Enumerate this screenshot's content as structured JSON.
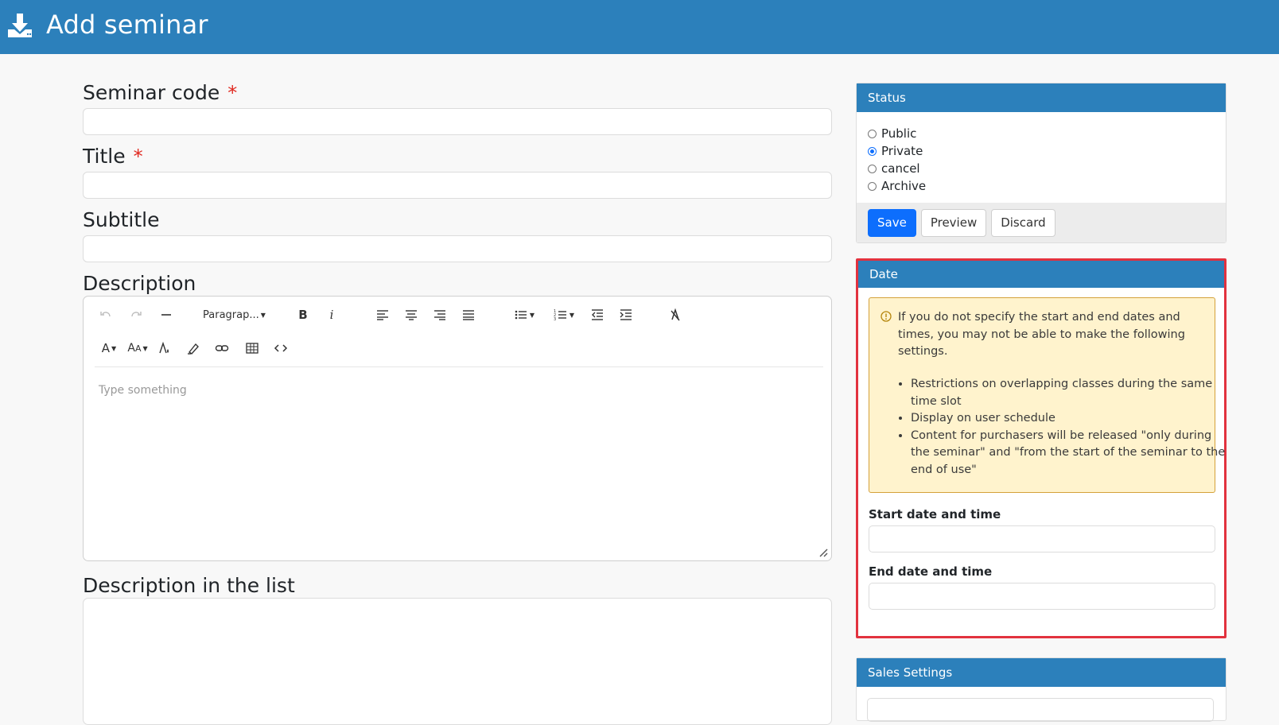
{
  "header": {
    "title": "Add seminar",
    "icon": "download-icon"
  },
  "form": {
    "seminar_code_label": "Seminar code",
    "title_label": "Title",
    "subtitle_label": "Subtitle",
    "description_label": "Description",
    "description_list_label": "Description in the list",
    "required_mark": "*",
    "editor": {
      "paragraph_select": "Paragrap...",
      "placeholder": "Type something"
    }
  },
  "status": {
    "header": "Status",
    "options": [
      "Public",
      "Private",
      "cancel",
      "Archive"
    ],
    "selected": "Private",
    "save": "Save",
    "preview": "Preview",
    "discard": "Discard"
  },
  "date": {
    "header": "Date",
    "warning": "If you do not specify the start and end dates and times, you may not be able to make the following settings.",
    "bullets": [
      "Restrictions on overlapping classes during the same time slot",
      "Display on user schedule",
      "Content for purchasers will be released \"only during the seminar\" and \"from the start of the seminar to the end of use\""
    ],
    "start_label": "Start date and time",
    "end_label": "End date and time"
  },
  "sales": {
    "header": "Sales Settings"
  },
  "colors": {
    "header_blue": "#2c80bb",
    "primary": "#0d6efd",
    "highlight": "#e2323f",
    "warning_bg": "#fff3cd"
  }
}
